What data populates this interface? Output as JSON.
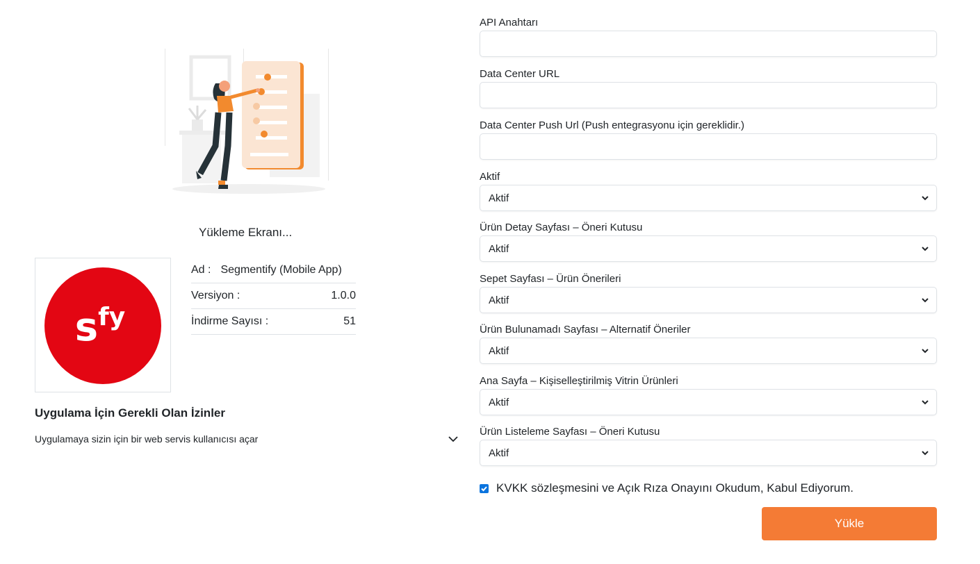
{
  "loading": {
    "title": "Yükleme Ekranı..."
  },
  "app": {
    "logo_text_s": "s",
    "logo_text_fy": "fy",
    "name_label": "Ad :",
    "name_value": "Segmentify (Mobile App)",
    "version_label": "Versiyon :",
    "version_value": "1.0.0",
    "downloads_label": "İndirme Sayısı :",
    "downloads_value": "51",
    "brand_color": "#e30613"
  },
  "permissions": {
    "title": "Uygulama İçin Gerekli Olan İzinler",
    "items": [
      {
        "text": "Uygulamaya sizin için bir web servis kullanıcısı açar"
      }
    ]
  },
  "form": {
    "api_key": {
      "label": "API Anahtarı",
      "value": ""
    },
    "data_center_url": {
      "label": "Data Center URL",
      "value": ""
    },
    "data_center_push_url": {
      "label": "Data Center Push Url (Push entegrasyonu için gereklidir.)",
      "value": ""
    },
    "selects": [
      {
        "label": "Aktif",
        "value": "Aktif"
      },
      {
        "label": "Ürün Detay Sayfası – Öneri Kutusu",
        "value": "Aktif"
      },
      {
        "label": "Sepet Sayfası – Ürün Önerileri",
        "value": "Aktif"
      },
      {
        "label": "Ürün Bulunamadı Sayfası – Alternatif Öneriler",
        "value": "Aktif"
      },
      {
        "label": "Ana Sayfa – Kişiselleştirilmiş Vitrin Ürünleri",
        "value": "Aktif"
      },
      {
        "label": "Ürün Listeleme Sayfası – Öneri Kutusu",
        "value": "Aktif"
      }
    ],
    "consent_label": "KVKK sözleşmesini ve Açık Rıza Onayını Okudum, Kabul Ediyorum.",
    "consent_checked": true,
    "submit_label": "Yükle",
    "accent_color": "#f47b35"
  }
}
